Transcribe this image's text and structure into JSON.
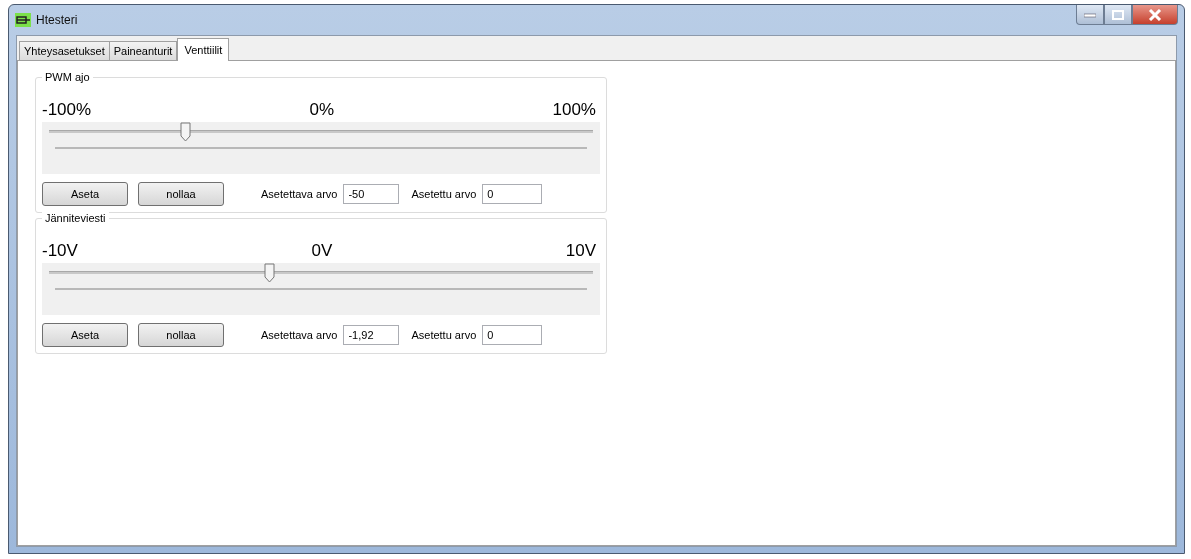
{
  "window": {
    "title": "Htesteri"
  },
  "tabs": [
    {
      "label": "Yhteysasetukset",
      "selected": false
    },
    {
      "label": "Paineanturit",
      "selected": false
    },
    {
      "label": "Venttiilit",
      "selected": true
    }
  ],
  "groups": [
    {
      "title": "PWM ajo",
      "scale_min": "-100%",
      "scale_mid": "0%",
      "scale_max": "100%",
      "level": 0.25,
      "set_button": "Aseta",
      "reset_button": "nollaa",
      "target_label": "Asetettava arvo",
      "target_value": "-50",
      "actual_label": "Asetettu arvo",
      "actual_value": "0"
    },
    {
      "title": "Jänniteviesti",
      "scale_min": "-10V",
      "scale_mid": "0V",
      "scale_max": "10V",
      "level": 0.404,
      "set_button": "Aseta",
      "reset_button": "nollaa",
      "target_label": "Asetettava arvo",
      "target_value": "-1,92",
      "actual_label": "Asetettu arvo",
      "actual_value": "0"
    }
  ]
}
